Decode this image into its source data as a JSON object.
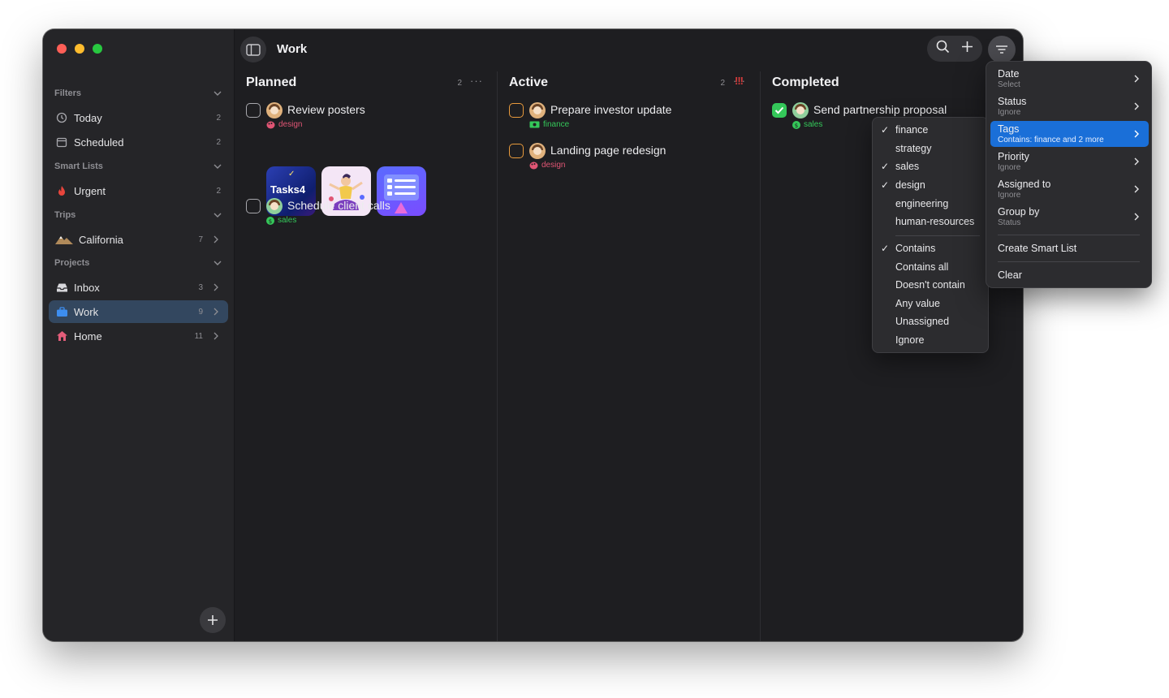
{
  "window": {
    "title": "Work"
  },
  "sidebar": {
    "sections": {
      "filters": "Filters",
      "smart_lists": "Smart Lists",
      "trips": "Trips",
      "projects": "Projects"
    },
    "items": [
      {
        "label": "Today",
        "count": "2",
        "icon": "clock-icon"
      },
      {
        "label": "Scheduled",
        "count": "2",
        "icon": "calendar-icon"
      },
      {
        "label": "Urgent",
        "count": "2",
        "icon": "flame-icon"
      },
      {
        "label": "California",
        "count": "7",
        "icon": "mountain-icon"
      },
      {
        "label": "Inbox",
        "count": "3",
        "icon": "inbox-icon"
      },
      {
        "label": "Work",
        "count": "9",
        "icon": "briefcase-icon"
      },
      {
        "label": "Home",
        "count": "11",
        "icon": "house-icon"
      }
    ]
  },
  "columns": {
    "planned": {
      "title": "Planned",
      "count": "2",
      "more": "···"
    },
    "active": {
      "title": "Active",
      "count": "2",
      "more": "···"
    },
    "completed": {
      "title": "Completed"
    }
  },
  "tasks": {
    "review_posters": {
      "title": "Review posters",
      "tag": "design",
      "thumb1_label": "Tasks4",
      "thumb1_check": "✓"
    },
    "schedule_calls": {
      "title": "Schedule client calls",
      "tag": "sales"
    },
    "investor_update": {
      "title": "Prepare investor update",
      "tag": "finance",
      "priority": "!!!"
    },
    "landing_page": {
      "title": "Landing page redesign",
      "tag": "design"
    },
    "partnership": {
      "title": "Send partnership proposal",
      "tag": "sales"
    }
  },
  "tags_submenu": {
    "options": [
      {
        "label": "finance",
        "checked": "✓"
      },
      {
        "label": "strategy",
        "checked": ""
      },
      {
        "label": "sales",
        "checked": "✓"
      },
      {
        "label": "design",
        "checked": "✓"
      },
      {
        "label": "engineering",
        "checked": ""
      },
      {
        "label": "human-resources",
        "checked": ""
      }
    ],
    "modes": [
      {
        "label": "Contains",
        "checked": "✓"
      },
      {
        "label": "Contains all",
        "checked": ""
      },
      {
        "label": "Doesn't contain",
        "checked": ""
      },
      {
        "label": "Any value",
        "checked": ""
      },
      {
        "label": "Unassigned",
        "checked": ""
      },
      {
        "label": "Ignore",
        "checked": ""
      }
    ]
  },
  "filter_menu": {
    "items": [
      {
        "label": "Date",
        "value": "Select"
      },
      {
        "label": "Status",
        "value": "Ignore"
      },
      {
        "label": "Tags",
        "value": "Contains: finance and 2 more"
      },
      {
        "label": "Priority",
        "value": "Ignore"
      },
      {
        "label": "Assigned to",
        "value": "Ignore"
      },
      {
        "label": "Group by",
        "value": "Status"
      }
    ],
    "create_smart_list": "Create Smart List",
    "clear": "Clear"
  },
  "colors": {
    "accent": "#1a6fd8",
    "selected_sidebar": "#33475f",
    "design_tag": "#e05574",
    "sales_tag": "#34c759",
    "priority": "#d43b3b"
  }
}
